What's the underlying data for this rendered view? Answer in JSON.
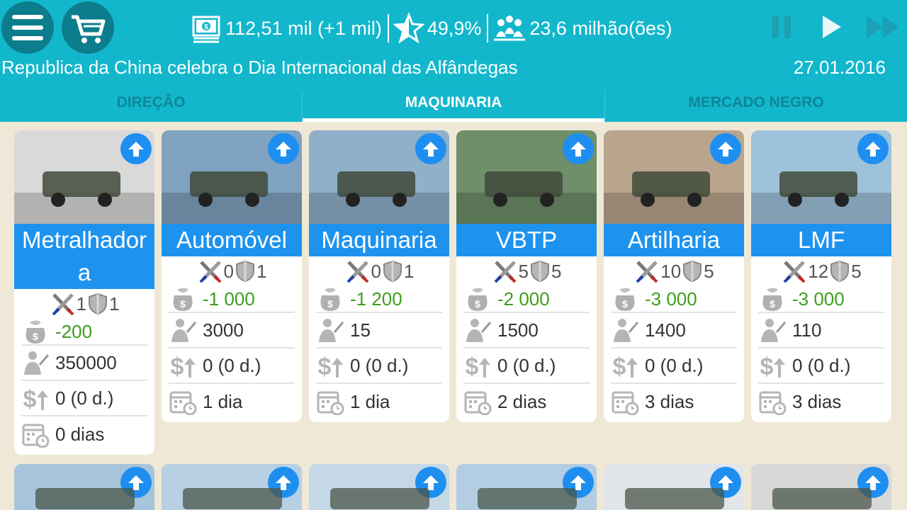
{
  "header": {
    "money": "112,51 mil (+1 mil)",
    "approval": "49,9%",
    "population": "23,6 milhão(ões)",
    "news": "Republica da China celebra o Dia Internacional das Alfândegas",
    "date": "27.01.2016"
  },
  "tabs": [
    {
      "label": "DIREÇÃO"
    },
    {
      "label": "MAQUINARIA"
    },
    {
      "label": "MERCADO NEGRO"
    }
  ],
  "cards": [
    {
      "title": "Metralhadora",
      "attack": "1",
      "defense": "1",
      "cost": "-200",
      "soldiers": "350000",
      "income": "0 (0 d.)",
      "time": "0 dias",
      "photo_color": "#d9d9d9"
    },
    {
      "title": "Automóvel",
      "attack": "0",
      "defense": "1",
      "cost": "-1 000",
      "soldiers": "3000",
      "income": "0 (0 d.)",
      "time": "1 dia",
      "photo_color": "#7fa3c0"
    },
    {
      "title": "Maquinaria",
      "attack": "0",
      "defense": "1",
      "cost": "-1 200",
      "soldiers": "15",
      "income": "0 (0 d.)",
      "time": "1 dia",
      "photo_color": "#8fb0c8"
    },
    {
      "title": "VBTP",
      "attack": "5",
      "defense": "5",
      "cost": "-2 000",
      "soldiers": "1500",
      "income": "0 (0 d.)",
      "time": "2 dias",
      "photo_color": "#6e8f6a"
    },
    {
      "title": "Artilharia",
      "attack": "10",
      "defense": "5",
      "cost": "-3 000",
      "soldiers": "1400",
      "income": "0 (0 d.)",
      "time": "3 dias",
      "photo_color": "#b9a58c"
    },
    {
      "title": "LMF",
      "attack": "12",
      "defense": "5",
      "cost": "-3 000",
      "soldiers": "110",
      "income": "0 (0 d.)",
      "time": "3 dias",
      "photo_color": "#9fc2dc"
    }
  ],
  "bottom_cards": [
    {
      "photo_color": "#a8c4dc"
    },
    {
      "photo_color": "#b8d0e4"
    },
    {
      "photo_color": "#c5d8e6"
    },
    {
      "photo_color": "#b3cde3"
    },
    {
      "photo_color": "#e2e6ea"
    },
    {
      "photo_color": "#d8d8d8"
    }
  ],
  "colors": {
    "header": "#12b7cc",
    "title_bar": "#1e93ee",
    "cost": "#3e9e1c",
    "background": "#efe8d6"
  }
}
